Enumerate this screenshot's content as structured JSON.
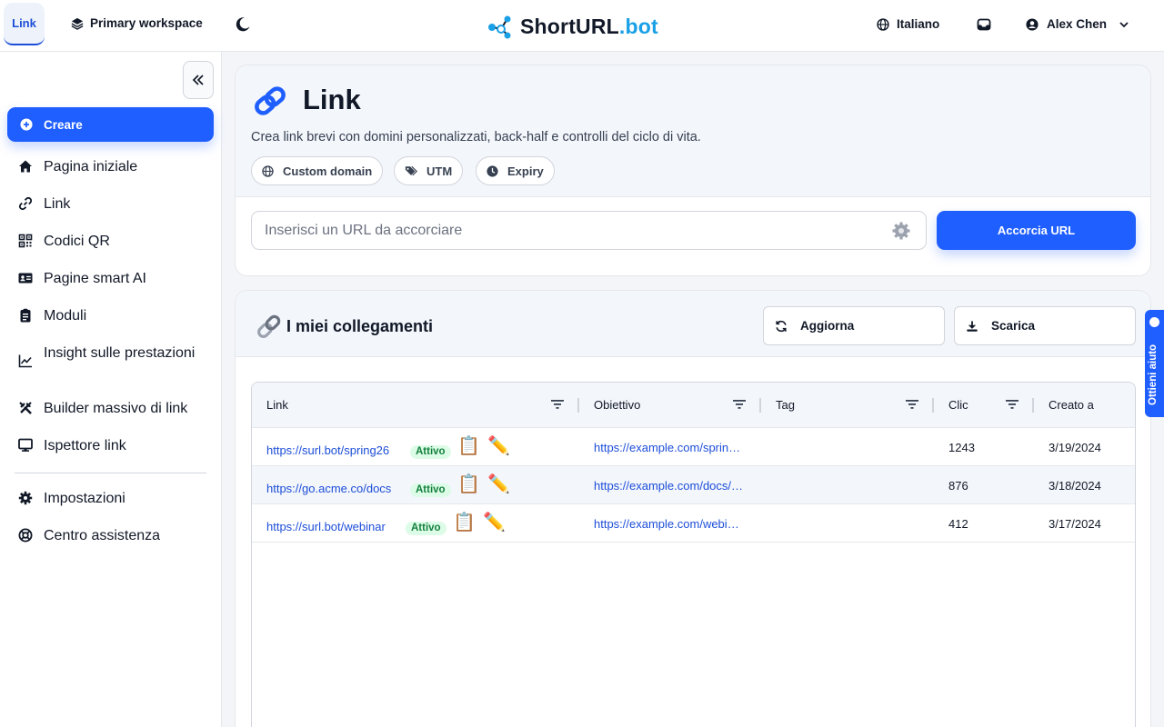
{
  "topbar": {
    "tab_label": "Link",
    "workspace": "Primary workspace",
    "brand_part1": "ShortURL",
    "brand_part2": ".bot",
    "language": "Italiano",
    "user_name": "Alex Chen"
  },
  "sidebar": {
    "create_label": "Creare",
    "items": [
      {
        "label": "Pagina iniziale",
        "icon": "home-icon"
      },
      {
        "label": "Link",
        "icon": "link-icon"
      },
      {
        "label": "Codici QR",
        "icon": "qr-code-icon"
      },
      {
        "label": "Pagine smart AI",
        "icon": "id-card-icon"
      },
      {
        "label": "Moduli",
        "icon": "clipboard-icon"
      },
      {
        "label": "Insight sulle prestazioni",
        "icon": "chart-line-icon"
      },
      {
        "label": "Builder massivo di link",
        "icon": "tools-icon"
      },
      {
        "label": "Ispettore link",
        "icon": "monitor-icon"
      },
      {
        "label": "Impostazioni",
        "icon": "gear-icon"
      },
      {
        "label": "Centro assistenza",
        "icon": "lifebuoy-icon"
      }
    ]
  },
  "create_card": {
    "title": "Link",
    "subtitle": "Crea link brevi con domini personalizzati, back-half e controlli del ciclo di vita.",
    "chips": [
      "Custom domain",
      "UTM",
      "Expiry"
    ],
    "url_placeholder": "Inserisci un URL da accorciare",
    "shorten_label": "Accorcia URL"
  },
  "links_card": {
    "title": "I miei collegamenti",
    "refresh_label": "Aggiorna",
    "download_label": "Scarica",
    "columns": [
      "Link",
      "Obiettivo",
      "Tag",
      "Clic",
      "Creato a"
    ],
    "rows": [
      {
        "link": "https://surl.bot/spring26",
        "status": "Attivo",
        "target": "https://example.com/spring-sale",
        "tag": "",
        "clicks": "1243",
        "created": "3/19/2024"
      },
      {
        "link": "https://go.acme.co/docs",
        "status": "Attivo",
        "target": "https://example.com/docs/getting-started",
        "tag": "",
        "clicks": "876",
        "created": "3/18/2024"
      },
      {
        "link": "https://surl.bot/webinar",
        "status": "Attivo",
        "target": "https://example.com/webinar",
        "tag": "",
        "clicks": "412",
        "created": "3/17/2024"
      }
    ]
  },
  "help_tab": "Ottieni aiuto",
  "colors": {
    "accent": "#1f5eff",
    "brand_blue": "#1aa0e6",
    "link_blue": "#1d4ed8",
    "badge_green": "#15803d"
  }
}
